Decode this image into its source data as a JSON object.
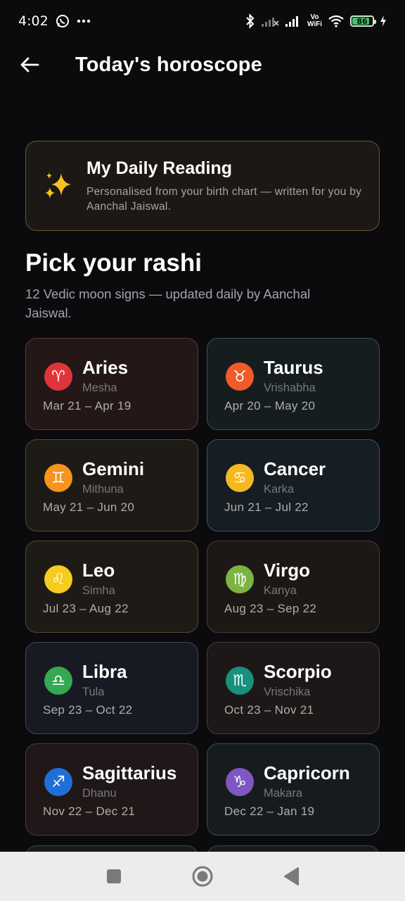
{
  "status_bar": {
    "time": "4:02",
    "vowifi_top": "Vo",
    "vowifi_bottom": "WiFi",
    "battery": "86",
    "battery_level": 0.86,
    "icons": [
      "whatsapp-icon",
      "more-dots-icon",
      "bluetooth-icon",
      "signal-off-icon",
      "signal-icon",
      "wifi-icon",
      "battery-icon",
      "charging-icon"
    ]
  },
  "header": {
    "title": "Today's horoscope",
    "back_icon": "arrow-left-icon"
  },
  "daily_reading": {
    "icon": "sparkles-icon",
    "title": "My Daily Reading",
    "subtitle": "Personalised from your birth chart — written for you by Aanchal Jaiswal."
  },
  "section": {
    "title": "Pick your rashi",
    "subtitle": "12 Vedic moon signs — updated daily by Aanchal Jaiswal."
  },
  "signs": [
    {
      "name": "Aries",
      "vedic": "Mesha",
      "dates": "Mar 21 – Apr 19",
      "symbol": "♈",
      "color": "#e0343a"
    },
    {
      "name": "Taurus",
      "vedic": "Vrishabha",
      "dates": "Apr 20 – May 20",
      "symbol": "♉",
      "color": "#f25a2a"
    },
    {
      "name": "Gemini",
      "vedic": "Mithuna",
      "dates": "May 21 – Jun 20",
      "symbol": "♊",
      "color": "#f7931e"
    },
    {
      "name": "Cancer",
      "vedic": "Karka",
      "dates": "Jun 21 – Jul 22",
      "symbol": "♋",
      "color": "#f5b820"
    },
    {
      "name": "Leo",
      "vedic": "Simha",
      "dates": "Jul 23 – Aug 22",
      "symbol": "♌",
      "color": "#f5cc1f"
    },
    {
      "name": "Virgo",
      "vedic": "Kanya",
      "dates": "Aug 23 – Sep 22",
      "symbol": "♍",
      "color": "#7cb342"
    },
    {
      "name": "Libra",
      "vedic": "Tula",
      "dates": "Sep 23 – Oct 22",
      "symbol": "♎",
      "color": "#34a853"
    },
    {
      "name": "Scorpio",
      "vedic": "Vrischika",
      "dates": "Oct 23 – Nov 21",
      "symbol": "♏",
      "color": "#17907d"
    },
    {
      "name": "Sagittarius",
      "vedic": "Dhanu",
      "dates": "Nov 22 – Dec 21",
      "symbol": "♐",
      "color": "#1e6fd9"
    },
    {
      "name": "Capricorn",
      "vedic": "Makara",
      "dates": "Dec 22 – Jan 19",
      "symbol": "♑",
      "color": "#7e57c2"
    }
  ],
  "nav_bar": {
    "buttons": [
      "recents-square-icon",
      "home-circle-icon",
      "back-triangle-icon"
    ]
  }
}
